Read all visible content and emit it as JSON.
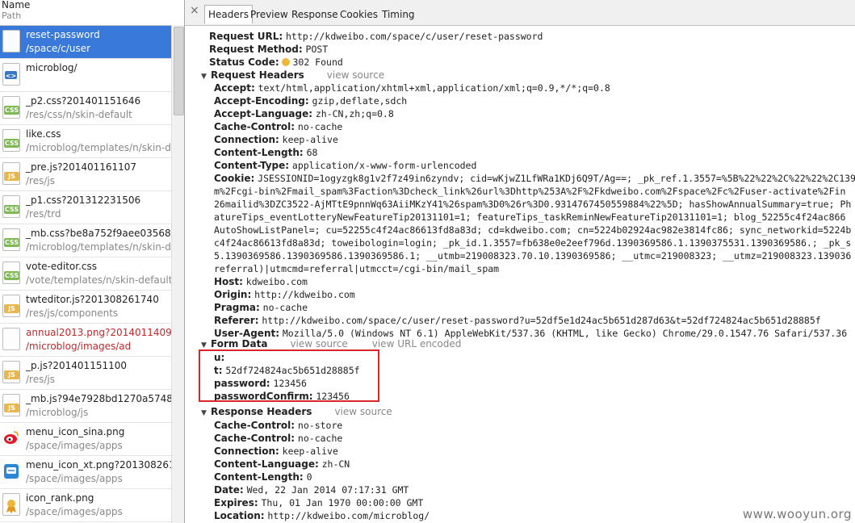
{
  "left": {
    "header_name": "Name",
    "header_path": "Path",
    "items": [
      {
        "name": "reset-password",
        "path": "/space/c/user",
        "icon": "document-icon",
        "type": "doc"
      },
      {
        "name": "microblog/",
        "path": "",
        "icon": "html-icon",
        "type": "html"
      },
      {
        "name": "_p2.css?201401151646",
        "path": "/res/css/n/skin-default",
        "icon": "css-icon",
        "type": "css",
        "badge": "CSS"
      },
      {
        "name": "like.css",
        "path": "/microblog/templates/n/skin-def",
        "icon": "css-icon",
        "type": "css",
        "badge": "CSS"
      },
      {
        "name": "_pre.js?201401161107",
        "path": "/res/js",
        "icon": "js-icon",
        "type": "js",
        "badge": "JS"
      },
      {
        "name": "_p1.css?201312231506",
        "path": "/res/trd",
        "icon": "css-icon",
        "type": "css",
        "badge": "CSS"
      },
      {
        "name": "_mb.css?be8a752f9aee03568fe4...",
        "path": "/microblog/templates/n/skin-de",
        "icon": "css-icon",
        "type": "css",
        "badge": "CSS"
      },
      {
        "name": "vote-editor.css",
        "path": "/vote/templates/n/skin-default",
        "icon": "css-icon",
        "type": "css",
        "badge": "CSS"
      },
      {
        "name": "twteditor.js?201308261740",
        "path": "/res/js/components",
        "icon": "js-icon",
        "type": "js",
        "badge": "JS"
      },
      {
        "name": "annual2013.png?201401140953",
        "path": "/microblog/images/ad",
        "icon": "image-icon",
        "type": "err"
      },
      {
        "name": "_p.js?201401151100",
        "path": "/res/js",
        "icon": "js-icon",
        "type": "js",
        "badge": "JS"
      },
      {
        "name": "_mb.js?94e7928bd1270a57488ea...",
        "path": "/microblog/js",
        "icon": "js-icon",
        "type": "js",
        "badge": "JS"
      },
      {
        "name": "menu_icon_sina.png",
        "path": "/space/images/apps",
        "icon": "weibo-icon",
        "type": "img"
      },
      {
        "name": "menu_icon_xt.png?201308261746",
        "path": "/space/images/apps",
        "icon": "app-icon",
        "type": "img"
      },
      {
        "name": "icon_rank.png",
        "path": "/space/images/apps",
        "icon": "rank-icon",
        "type": "img"
      }
    ]
  },
  "tabs": {
    "close": "×",
    "items": [
      "Headers",
      "Preview",
      "Response",
      "Cookies",
      "Timing"
    ],
    "active": "Headers"
  },
  "general": [
    {
      "k": "Request URL:",
      "v": "http://kdweibo.com/space/c/user/reset-password"
    },
    {
      "k": "Request Method:",
      "v": "POST"
    },
    {
      "k": "Status Code:",
      "v": "302 Found"
    }
  ],
  "request_headers": {
    "title": "Request Headers",
    "link": "view source",
    "rows": [
      {
        "k": "Accept:",
        "v": "text/html,application/xhtml+xml,application/xml;q=0.9,*/*;q=0.8"
      },
      {
        "k": "Accept-Encoding:",
        "v": "gzip,deflate,sdch"
      },
      {
        "k": "Accept-Language:",
        "v": "zh-CN,zh;q=0.8"
      },
      {
        "k": "Cache-Control:",
        "v": "no-cache"
      },
      {
        "k": "Connection:",
        "v": "keep-alive"
      },
      {
        "k": "Content-Length:",
        "v": "68"
      },
      {
        "k": "Content-Type:",
        "v": "application/x-www-form-urlencoded"
      },
      {
        "k": "Cookie:",
        "v": "JSESSIONID=1ogyzgk8g1v2f7z49in6zyndv; cid=wKjwZ1LfWRa1KDj6Q9T/Ag==; _pk_ref.1.3557=%5B%22%22%2C%22%22%2C139"
      },
      {
        "k": "",
        "v": "m%2Fcgi-bin%2Fmail_spam%3Faction%3Dcheck_link%26url%3Dhttp%253A%2F%2Fkdweibo.com%2Fspace%2Fc%2Fuser-activate%2Fin"
      },
      {
        "k": "",
        "v": "26mailid%3DZC3522-AjMTtE9pnnWq63AiiMKzY41%26spam%3D0%26r%3D0.9314767450559884%22%5D; hasShowAnnualSummary=true; Ph"
      },
      {
        "k": "",
        "v": "atureTips_eventLotteryNewFeatureTip20131101=1; featureTips_taskReminNewFeatureTip20131101=1; blog_52255c4f24ac866"
      },
      {
        "k": "",
        "v": "AutoShowListPanel=; cu=52255c4f24ac86613fd8a83d; cd=kdweibo.com; cn=5224b02924ac982e3814fc86; sync_networkid=5224b"
      },
      {
        "k": "",
        "v": "c4f24ac86613fd8a83d; toweibologin=login; _pk_id.1.3557=fb638e0e2eef796d.1390369586.1.1390375531.1390369586.; _pk_s"
      },
      {
        "k": "",
        "v": "5.1390369586.1390369586.1390369586.1; __utmb=219008323.70.10.1390369586; __utmc=219008323; __utmz=219008323.139036"
      },
      {
        "k": "",
        "v": "referral)|utmcmd=referral|utmcct=/cgi-bin/mail_spam"
      },
      {
        "k": "Host:",
        "v": "kdweibo.com"
      },
      {
        "k": "Origin:",
        "v": "http://kdweibo.com"
      },
      {
        "k": "Pragma:",
        "v": "no-cache"
      },
      {
        "k": "Referer:",
        "v": "http://kdweibo.com/space/c/user/reset-password?u=52df5e1d24ac5b651d287d63&t=52df724824ac5b651d28885f"
      },
      {
        "k": "User-Agent:",
        "v": "Mozilla/5.0 (Windows NT 6.1) AppleWebKit/537.36 (KHTML, like Gecko) Chrome/29.0.1547.76 Safari/537.36"
      }
    ]
  },
  "form_data": {
    "title": "Form Data",
    "link1": "view source",
    "link2": "view URL encoded",
    "rows": [
      {
        "k": "u:",
        "v": ""
      },
      {
        "k": "t:",
        "v": "52df724824ac5b651d28885f"
      },
      {
        "k": "password:",
        "v": "123456"
      },
      {
        "k": "passwordConfirm:",
        "v": "123456"
      }
    ],
    "highlight_color": "#d8262c"
  },
  "response_headers": {
    "title": "Response Headers",
    "link": "view source",
    "rows": [
      {
        "k": "Cache-Control:",
        "v": "no-store"
      },
      {
        "k": "Cache-Control:",
        "v": "no-cache"
      },
      {
        "k": "Connection:",
        "v": "keep-alive"
      },
      {
        "k": "Content-Language:",
        "v": "zh-CN"
      },
      {
        "k": "Content-Length:",
        "v": "0"
      },
      {
        "k": "Date:",
        "v": "Wed, 22 Jan 2014 07:17:31 GMT"
      },
      {
        "k": "Expires:",
        "v": "Thu, 01 Jan 1970 00:00:00 GMT"
      },
      {
        "k": "Location:",
        "v": "http://kdweibo.com/microblog/"
      }
    ]
  },
  "watermark": "www.wooyun.org",
  "colors": {
    "selected": "#3879d9",
    "error": "#c0282b",
    "status_dot": "#f0b63a"
  }
}
